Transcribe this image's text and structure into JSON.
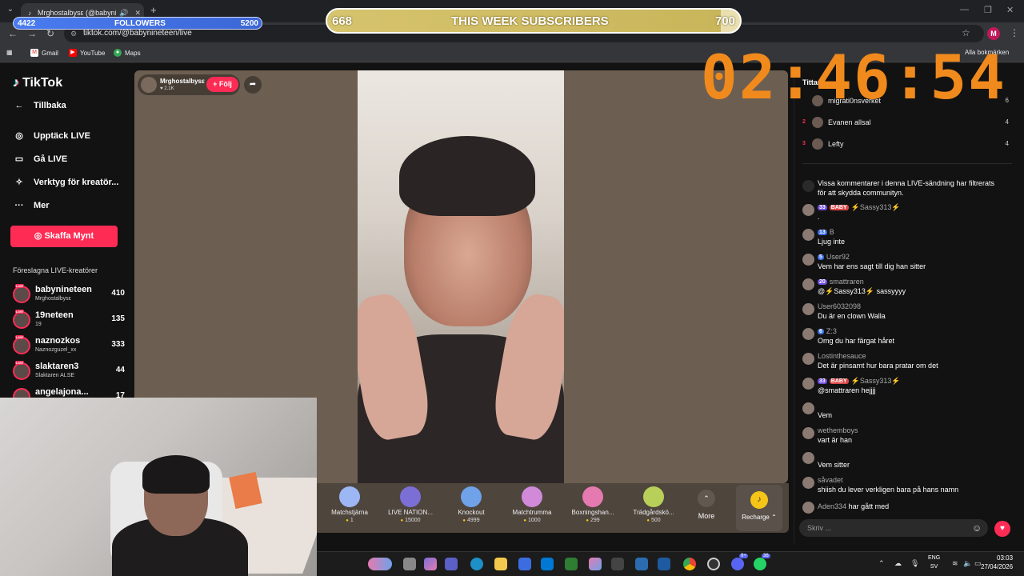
{
  "browser": {
    "tab_title": "Mrghostalbysε (@babynine",
    "address": "tiktok.com/@babynineteen/live",
    "bookmarks": [
      "Gmail",
      "YouTube",
      "Maps"
    ],
    "bookmarks_other": "Alla bokmärken",
    "profile_letter": "M"
  },
  "overlay": {
    "followers_current": "4422",
    "followers_label": "FOLLOWERS",
    "followers_goal": "5200",
    "followers_progress": 0.85,
    "subs_current": "668",
    "subs_label": "THIS WEEK SUBSCRIBERS",
    "subs_goal": "700",
    "subs_progress": 0.954,
    "timer": "02:46:54"
  },
  "sidebar": {
    "logo": "TikTok",
    "back": "Tillbaka",
    "items": [
      "Upptäck LIVE",
      "Gå LIVE",
      "Verktyg för kreatör...",
      "Mer"
    ],
    "buy_button": "Skaffa Mynt",
    "suggested_title": "Föreslagna LIVE-kreatörer",
    "creators": [
      {
        "name": "babynineteen",
        "sub": "Mrghostalbysε",
        "count": "410"
      },
      {
        "name": "19neteen",
        "sub": "19",
        "count": "135"
      },
      {
        "name": "naznozkos",
        "sub": "Naznozguzel_xx",
        "count": "333"
      },
      {
        "name": "slaktaren3",
        "sub": "Slaktaren ALSE",
        "count": "44"
      },
      {
        "name": "angelajona...",
        "sub": "",
        "count": "17"
      }
    ]
  },
  "stream": {
    "host_name": "Mrghostalbysε",
    "host_likes": "2.1K",
    "follow_label": "+ Följ"
  },
  "gifts": [
    {
      "name": "Matchstjärna",
      "price": "1",
      "color": "#9db7f5"
    },
    {
      "name": "LIVE NATION...",
      "price": "15000",
      "color": "#7b6fd6"
    },
    {
      "name": "Knockout",
      "price": "4999",
      "color": "#6fa2e8"
    },
    {
      "name": "Matchtrumma",
      "price": "1000",
      "color": "#d08ad9"
    },
    {
      "name": "Boxningshan...",
      "price": "299",
      "color": "#e57ab0"
    },
    {
      "name": "Trädgårdskö...",
      "price": "500",
      "color": "#b8d05a"
    }
  ],
  "gift_more": "More",
  "recharge": "Recharge",
  "chat": {
    "viewers_title": "Tittare",
    "viewers": [
      {
        "rank": "",
        "name": "migrati0nsverket",
        "score": "6"
      },
      {
        "rank": "2",
        "name": "Evanen allsal",
        "score": "4"
      },
      {
        "rank": "3",
        "name": "Lefty",
        "score": "4"
      }
    ],
    "comments": [
      {
        "user": "",
        "badges": [],
        "text": "Vissa kommentarer i denna LIVE-sändning har filtrerats",
        "text2": "för att skydda communityn.",
        "system": true
      },
      {
        "user": "⚡Sassy313⚡",
        "badges": [
          [
            "33",
            "b-purple"
          ],
          [
            "BABY",
            "b-red"
          ]
        ],
        "text": "."
      },
      {
        "user": "B",
        "badges": [
          [
            "13",
            "b-blue"
          ]
        ],
        "text": "Ljug inte"
      },
      {
        "user": "User92",
        "badges": [
          [
            "5",
            "b-blue"
          ]
        ],
        "text": "Vem har ens sagt till dig han sitter"
      },
      {
        "user": "smattraren",
        "badges": [
          [
            "20",
            "b-purple"
          ]
        ],
        "text": "@⚡Sassy313⚡ sassyyyy"
      },
      {
        "user": "User6032098",
        "badges": [],
        "text": "Du är en clown Walla"
      },
      {
        "user": "Z:3",
        "badges": [
          [
            "6",
            "b-blue"
          ]
        ],
        "text": "Omg du har färgat håret"
      },
      {
        "user": "Lostinthesauce",
        "badges": [],
        "text": "Det är pinsamt hur bara pratar om det"
      },
      {
        "user": "⚡Sassy313⚡",
        "badges": [
          [
            "33",
            "b-purple"
          ],
          [
            "BABY",
            "b-red"
          ]
        ],
        "text": "@smattraren hejjjj"
      },
      {
        "user": "",
        "badges": [],
        "text": "Vem"
      },
      {
        "user": "wethemboys",
        "badges": [],
        "text": "vart är han"
      },
      {
        "user": "",
        "badges": [],
        "text": "Vem sitter"
      },
      {
        "user": "såvadet",
        "badges": [],
        "text": "shiish du lever verkligen bara på hans namn"
      },
      {
        "user": "Aden334",
        "badges": [],
        "text": "har gått med",
        "joined": true
      }
    ],
    "input_placeholder": "Skriv ..."
  },
  "taskbar": {
    "lang_line1": "ENG",
    "lang_line2": "SV",
    "time": "03:03",
    "date": "27/04/2026",
    "discord_badge": "9+",
    "whatsapp_badge": "36"
  }
}
